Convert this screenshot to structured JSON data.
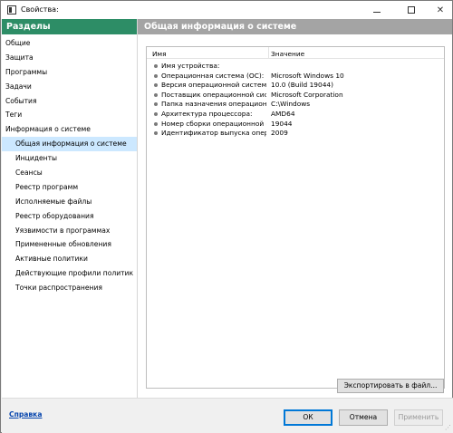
{
  "window": {
    "title": "Свойства:",
    "minimize_label": "",
    "maximize_label": "",
    "close_label": "✕"
  },
  "sidebar": {
    "header": "Разделы",
    "items": [
      {
        "label": "Общие",
        "level": 0,
        "selected": false
      },
      {
        "label": "Защита",
        "level": 0,
        "selected": false
      },
      {
        "label": "Программы",
        "level": 0,
        "selected": false
      },
      {
        "label": "Задачи",
        "level": 0,
        "selected": false
      },
      {
        "label": "События",
        "level": 0,
        "selected": false
      },
      {
        "label": "Теги",
        "level": 0,
        "selected": false
      },
      {
        "label": "Информация о системе",
        "level": 0,
        "selected": false
      },
      {
        "label": "Общая информация о системе",
        "level": 1,
        "selected": true
      },
      {
        "label": "Инциденты",
        "level": 1,
        "selected": false
      },
      {
        "label": "Сеансы",
        "level": 1,
        "selected": false
      },
      {
        "label": "Реестр программ",
        "level": 1,
        "selected": false
      },
      {
        "label": "Исполняемые файлы",
        "level": 1,
        "selected": false
      },
      {
        "label": "Реестр оборудования",
        "level": 1,
        "selected": false
      },
      {
        "label": "Уязвимости в программах",
        "level": 1,
        "selected": false
      },
      {
        "label": "Примененные обновления",
        "level": 1,
        "selected": false
      },
      {
        "label": "Активные политики",
        "level": 1,
        "selected": false
      },
      {
        "label": "Действующие профили политик",
        "level": 1,
        "selected": false
      },
      {
        "label": "Точки распространения",
        "level": 1,
        "selected": false
      }
    ]
  },
  "main": {
    "header": "Общая информация о системе",
    "columns": {
      "name": "Имя",
      "value": "Значение"
    },
    "rows": [
      {
        "name": "Имя устройства:",
        "value": ""
      },
      {
        "name": "Операционная система (ОС):",
        "value": "Microsoft Windows 10"
      },
      {
        "name": "Версия операционной системы:",
        "value": "10.0 (Build 19044)"
      },
      {
        "name": "Поставщик операционной системы:",
        "value": "Microsoft Corporation"
      },
      {
        "name": "Папка назначения операционной системы:",
        "value": "C:\\Windows"
      },
      {
        "name": "Архитектура процессора:",
        "value": "AMD64"
      },
      {
        "name": "Номер сборки операционной системы:",
        "value": "19044"
      },
      {
        "name": "Идентификатор выпуска операционной системы:",
        "value": "2009"
      }
    ],
    "export_label": "Экспортировать в файл..."
  },
  "footer": {
    "help_label": "Справка",
    "ok_label": "ОК",
    "cancel_label": "Отмена",
    "apply_label": "Применить"
  },
  "colors": {
    "sidebar_header": "#2d8d66",
    "main_header": "#a4a4a4",
    "selected_row": "#cce8ff",
    "ok_border": "#0078d7"
  }
}
